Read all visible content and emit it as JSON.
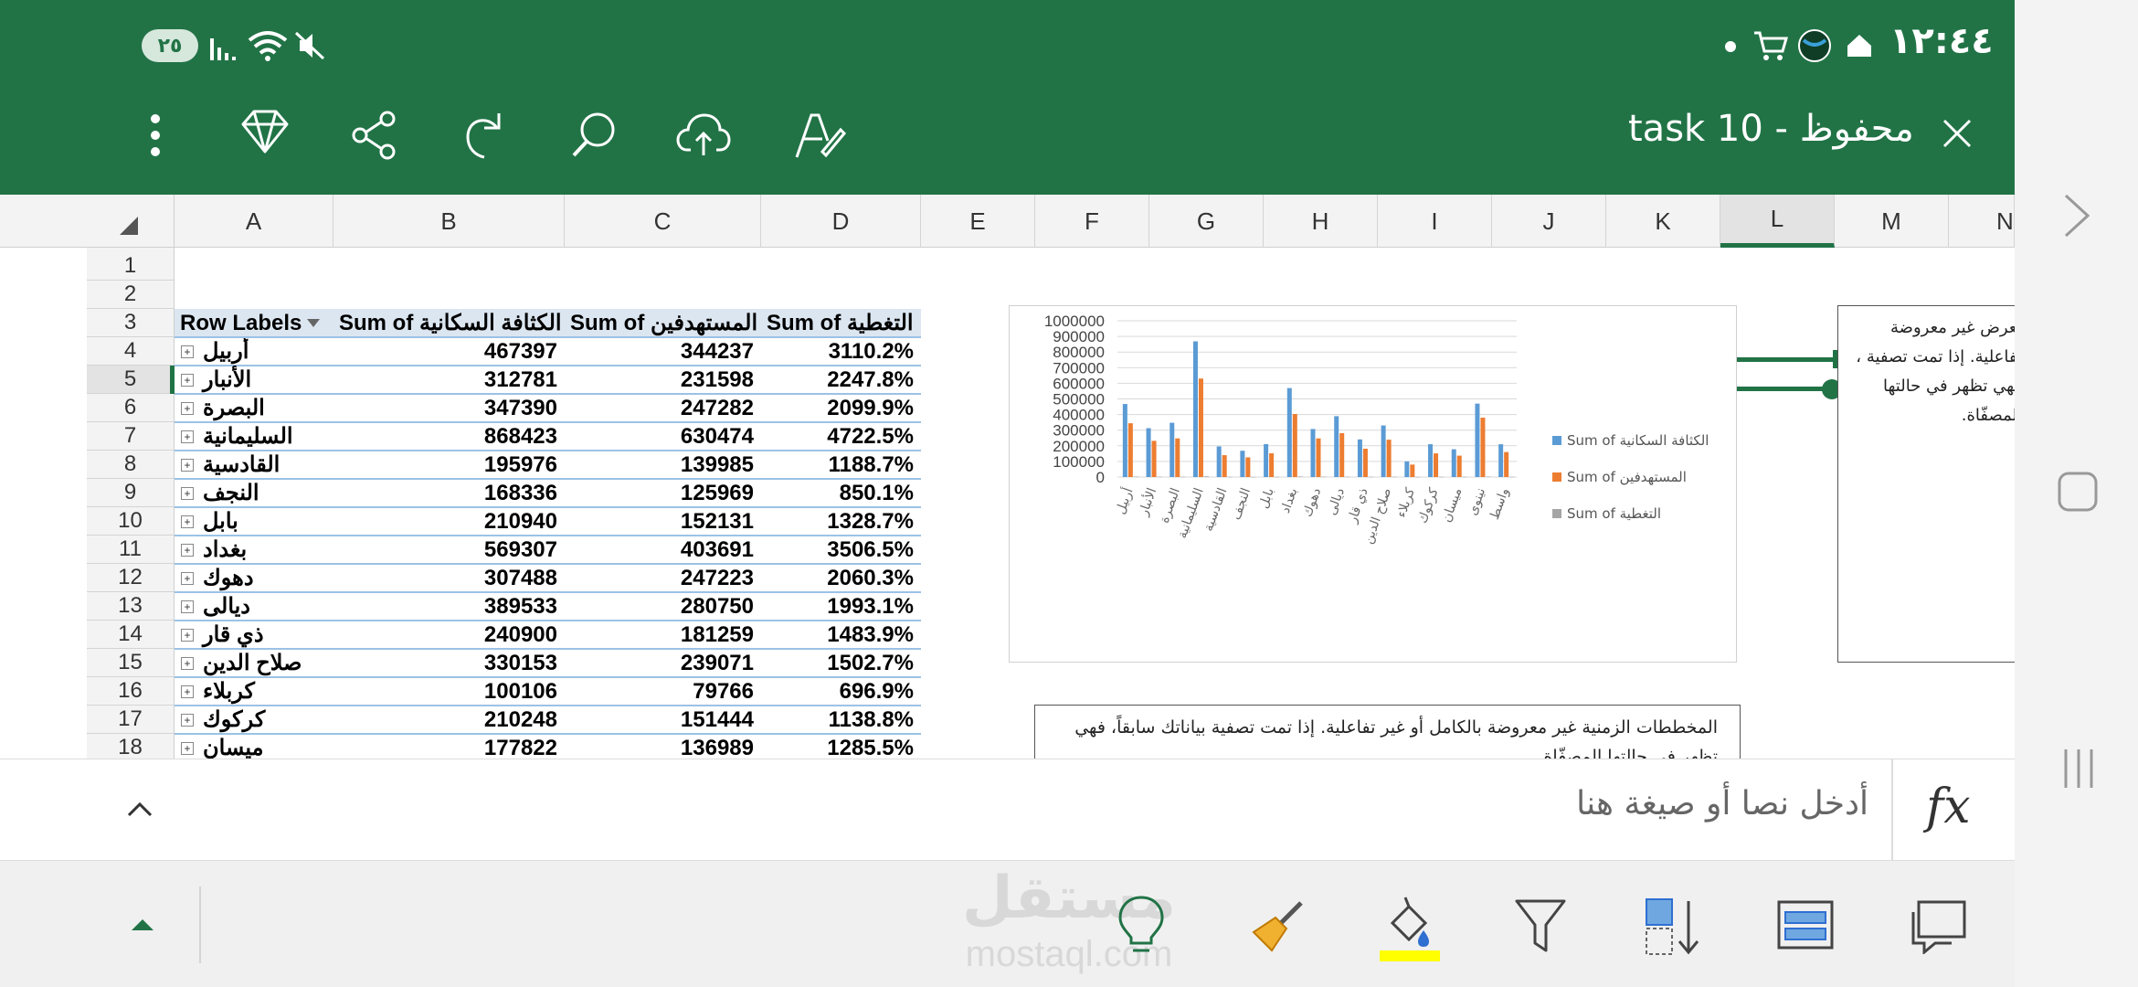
{
  "status_bar": {
    "time": "١٢:٤٤",
    "battery": "٢٥"
  },
  "toolbar": {
    "doc_title": "task 10 - محفوظ"
  },
  "columns": [
    "A",
    "B",
    "C",
    "D",
    "E",
    "F",
    "G",
    "H",
    "I",
    "J",
    "K",
    "L",
    "M",
    "N"
  ],
  "selected_column": "L",
  "rows": [
    "1",
    "2",
    "3",
    "4",
    "5",
    "6",
    "7",
    "8",
    "9",
    "10",
    "11",
    "12",
    "13",
    "14",
    "15",
    "16",
    "17",
    "18"
  ],
  "selected_row": "5",
  "pivot": {
    "headers": [
      "Row Labels",
      "Sum of الكثافة السكانية",
      "Sum of المستهدفين",
      "Sum of التغطية"
    ],
    "data": [
      [
        "أربيل",
        "467397",
        "344237",
        "3110.2%"
      ],
      [
        "الأنبار",
        "312781",
        "231598",
        "2247.8%"
      ],
      [
        "البصرة",
        "347390",
        "247282",
        "2099.9%"
      ],
      [
        "السليمانية",
        "868423",
        "630474",
        "4722.5%"
      ],
      [
        "القادسية",
        "195976",
        "139985",
        "1188.7%"
      ],
      [
        "النجف",
        "168336",
        "125969",
        "850.1%"
      ],
      [
        "بابل",
        "210940",
        "152131",
        "1328.7%"
      ],
      [
        "بغداد",
        "569307",
        "403691",
        "3506.5%"
      ],
      [
        "دهوك",
        "307488",
        "247223",
        "2060.3%"
      ],
      [
        "ديالى",
        "389533",
        "280750",
        "1993.1%"
      ],
      [
        "ذي قار",
        "240900",
        "181259",
        "1483.9%"
      ],
      [
        "صلاح الدين",
        "330153",
        "239071",
        "1502.7%"
      ],
      [
        "كربلاء",
        "100106",
        "79766",
        "696.9%"
      ],
      [
        "كركوك",
        "210248",
        "151444",
        "1138.8%"
      ],
      [
        "ميسان",
        "177822",
        "136989",
        "1285.5%"
      ]
    ]
  },
  "chart_data": {
    "type": "bar",
    "categories": [
      "أربيل",
      "الأنبار",
      "البصرة",
      "السليمانية",
      "القادسية",
      "النجف",
      "بابل",
      "بغداد",
      "دهوك",
      "ديالى",
      "ذي قار",
      "صلاح الدين",
      "كربلاء",
      "كركوك",
      "ميسان",
      "نينوى",
      "واسط"
    ],
    "series": [
      {
        "name": "Sum of الكثافة السكانية",
        "values": [
          467397,
          312781,
          347390,
          868423,
          195976,
          168336,
          210940,
          569307,
          307488,
          389533,
          240900,
          330153,
          100106,
          210248,
          177822,
          470000,
          210000
        ],
        "color": "#5b9bd5"
      },
      {
        "name": "Sum of المستهدفين",
        "values": [
          344237,
          231598,
          247282,
          630474,
          139985,
          125969,
          152131,
          403691,
          247223,
          280750,
          181259,
          239071,
          79766,
          151444,
          136989,
          380000,
          160000
        ],
        "color": "#ed7d31"
      },
      {
        "name": "Sum of التغطية",
        "values": [
          3110.2,
          2247.8,
          2099.9,
          4722.5,
          1188.7,
          850.1,
          1328.7,
          3506.5,
          2060.3,
          1993.1,
          1483.9,
          1502.7,
          696.9,
          1138.8,
          1285.5,
          3000,
          1500
        ],
        "color": "#a5a5a5"
      }
    ],
    "yticks": [
      "1000000",
      "900000",
      "800000",
      "700000",
      "600000",
      "500000",
      "400000",
      "300000",
      "200000",
      "100000",
      "0"
    ],
    "ylim": [
      0,
      1000000
    ],
    "legend": "right",
    "grid": true
  },
  "notes": {
    "right_box": "لعرض غير معروضة تفاعلية. إذا تمت تصفية ، فهي تظهر في حالتها المصفّاة.",
    "timeline_box": "المخططات الزمنية غير معروضة بالكامل أو غير تفاعلية. إذا تمت تصفية بياناتك سابقاً، فهي تظهر في حالتها المصفّاة"
  },
  "formula_bar": {
    "placeholder": "أدخل نصا أو صيغة هنا",
    "fx": "fx"
  },
  "watermark": {
    "text": "مستقل",
    "subtext": "mostaql.com"
  }
}
